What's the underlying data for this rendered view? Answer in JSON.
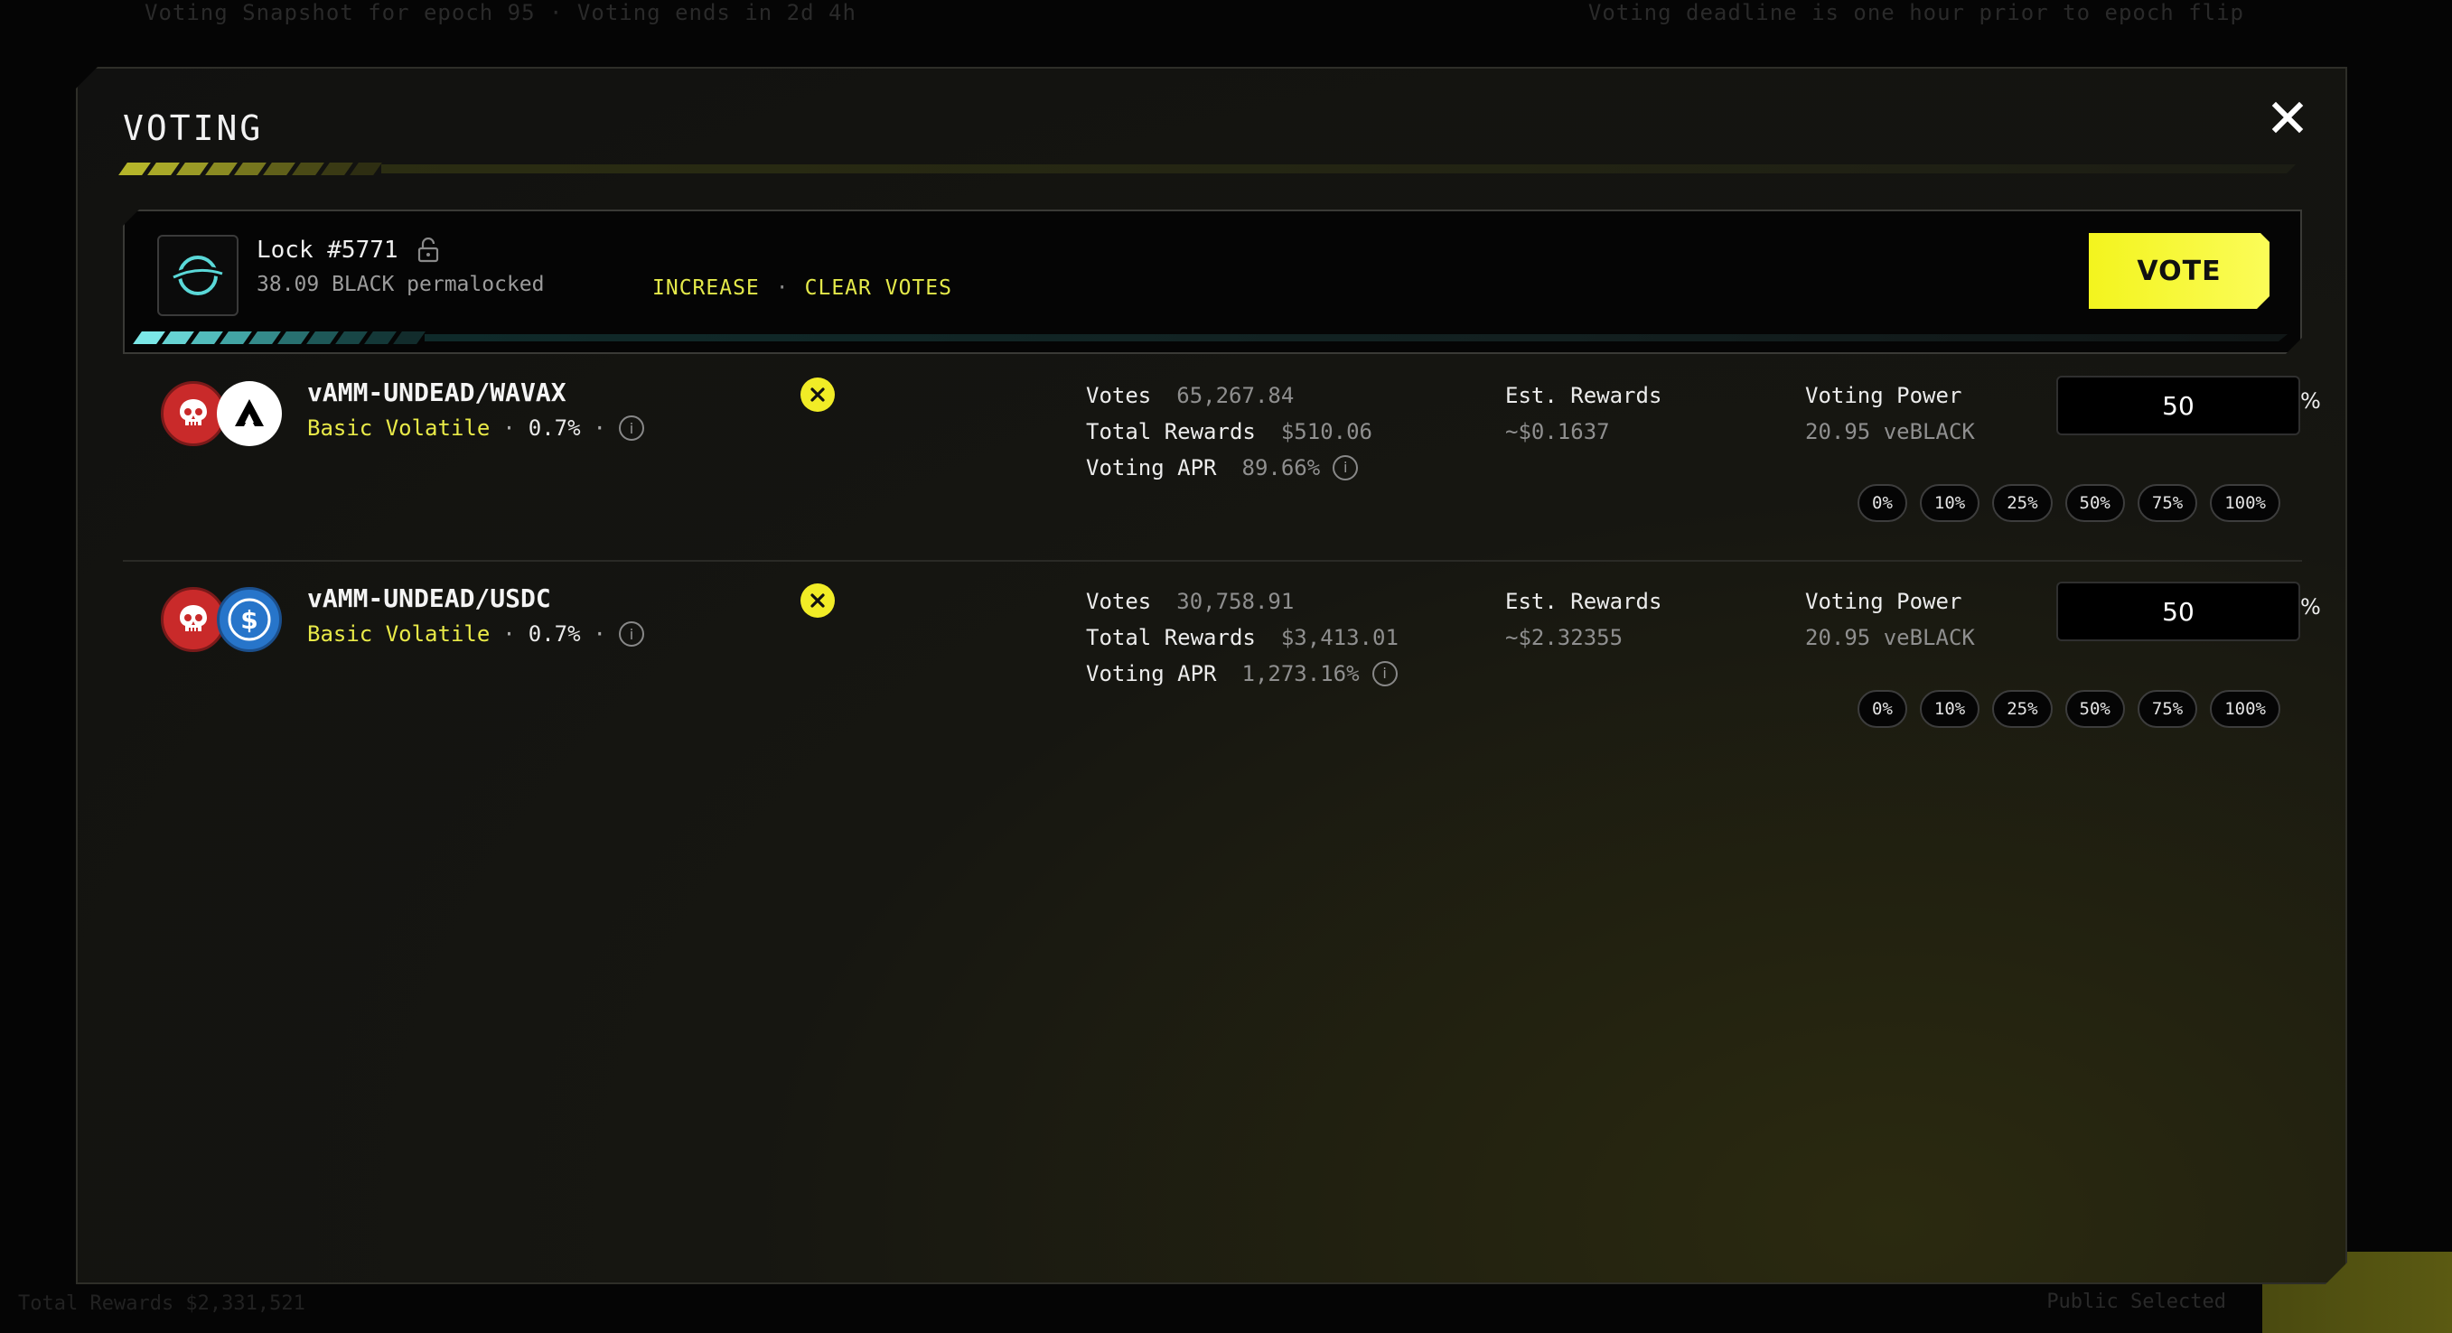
{
  "background": {
    "top_left": "Voting Snapshot for epoch 95 · Voting ends in 2d 4h",
    "top_right": "Voting deadline is one hour prior to epoch flip",
    "bottom_left": "Total Rewards $2,331,521",
    "bottom_mid": "Public Selected"
  },
  "modal": {
    "title": "VOTING",
    "close_label": "✕"
  },
  "lock": {
    "title": "Lock #5771",
    "subtitle": "38.09 BLACK permalocked",
    "increase_label": "INCREASE",
    "separator": "·",
    "clear_label": "CLEAR VOTES",
    "vote_label": "VOTE"
  },
  "pools": [
    {
      "name": "vAMM-UNDEAD/WAVAX",
      "type": "Basic Volatile",
      "fee": "0.7%",
      "sep": "·",
      "votes_label": "Votes",
      "votes": "65,267.84",
      "total_rewards_label": "Total Rewards",
      "total_rewards": "$510.06",
      "apr_label": "Voting APR",
      "apr": "89.66%",
      "est_label": "Est. Rewards",
      "est": "~$0.1637",
      "vp_label": "Voting Power",
      "vp": "20.95 veBLACK",
      "input_value": "50",
      "pct_sign": "%",
      "quick": [
        "0%",
        "10%",
        "25%",
        "50%",
        "75%",
        "100%"
      ]
    },
    {
      "name": "vAMM-UNDEAD/USDC",
      "type": "Basic Volatile",
      "fee": "0.7%",
      "sep": "·",
      "votes_label": "Votes",
      "votes": "30,758.91",
      "total_rewards_label": "Total Rewards",
      "total_rewards": "$3,413.01",
      "apr_label": "Voting APR",
      "apr": "1,273.16%",
      "est_label": "Est. Rewards",
      "est": "~$2.32355",
      "vp_label": "Voting Power",
      "vp": "20.95 veBLACK",
      "input_value": "50",
      "pct_sign": "%",
      "quick": [
        "0%",
        "10%",
        "25%",
        "50%",
        "75%",
        "100%"
      ]
    }
  ],
  "colors": {
    "accent_yellow": "#f3f41e",
    "remove_yellow": "#f1ec26",
    "teal": "#5ad8d8",
    "undead_red": "#c92a2a",
    "usdc_blue": "#2775ca"
  },
  "icons": {
    "close": "close-icon",
    "lock_open": "lock-open-icon",
    "lock_avatar": "black-logo-icon",
    "remove": "remove-icon",
    "info": "info-icon",
    "skull": "skull-icon",
    "avax": "avax-icon",
    "usdc": "usdc-icon"
  }
}
